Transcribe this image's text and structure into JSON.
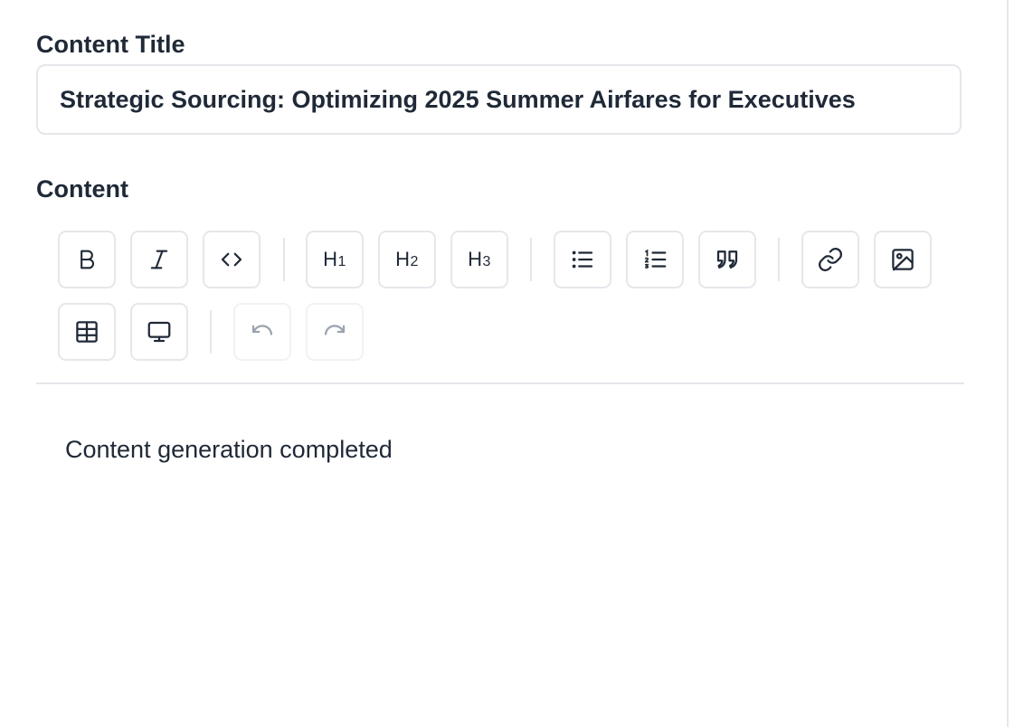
{
  "form": {
    "title_label": "Content Title",
    "title_value": "Strategic Sourcing: Optimizing 2025 Summer Airfares for Executives",
    "content_label": "Content"
  },
  "toolbar": {
    "h1": "H",
    "h1_sub": "1",
    "h2": "H",
    "h2_sub": "2",
    "h3": "H",
    "h3_sub": "3",
    "icons": {
      "bold": "bold-icon",
      "italic": "italic-icon",
      "code": "code-icon",
      "bullet_list": "bullet-list-icon",
      "ordered_list": "ordered-list-icon",
      "quote": "quote-icon",
      "link": "link-icon",
      "image": "image-icon",
      "table": "table-icon",
      "preview": "monitor-icon",
      "undo": "undo-icon",
      "redo": "redo-icon"
    }
  },
  "editor": {
    "body_text": "Content generation completed"
  },
  "colors": {
    "text": "#1f2937",
    "border": "#e5e7eb",
    "disabled": "#9ca3af"
  }
}
